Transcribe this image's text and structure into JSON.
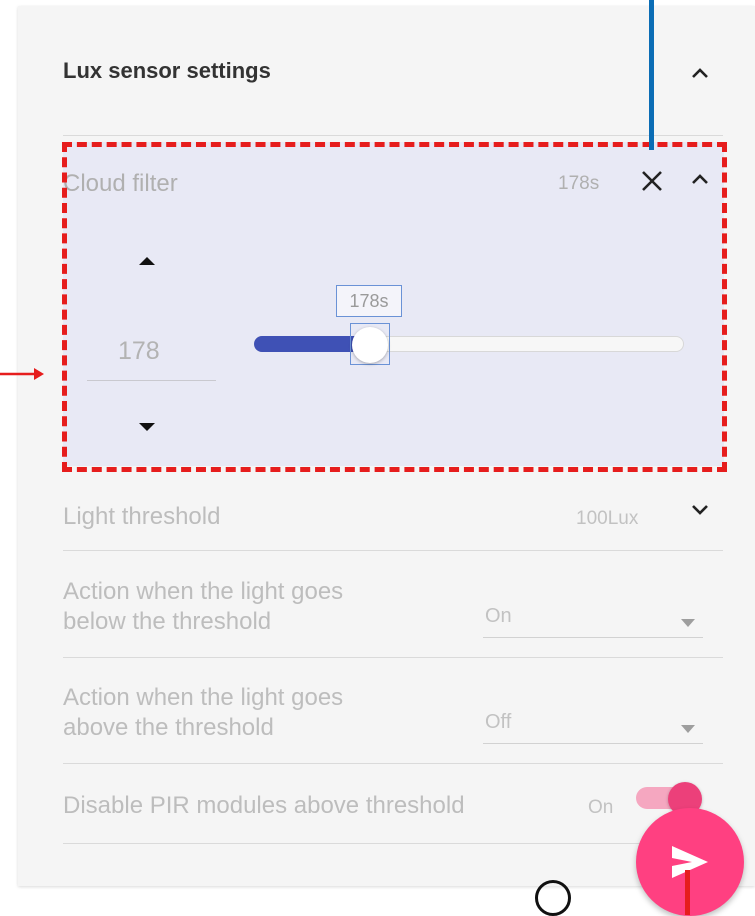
{
  "section": {
    "title": "Lux sensor settings"
  },
  "cloud_filter": {
    "label": "Cloud filter",
    "value_display": "178s",
    "number_value": "178",
    "slider_tooltip": "178s",
    "slider_fraction": 0.27
  },
  "light_threshold": {
    "label": "Light threshold",
    "value_display": "100Lux"
  },
  "action_below": {
    "label_line1": "Action when the light goes",
    "label_line2": "below the threshold",
    "selected": "On"
  },
  "action_above": {
    "label_line1": "Action when the light goes",
    "label_line2": "above the threshold",
    "selected": "Off"
  },
  "disable_pir": {
    "label": "Disable PIR modules above threshold",
    "state_text": "On"
  },
  "icons": {
    "section_collapse": "chevron-up-icon",
    "cloud_close": "close-icon",
    "cloud_collapse": "chevron-up-icon",
    "number_increment": "triangle-up-icon",
    "number_decrement": "triangle-down-icon",
    "threshold_expand": "chevron-down-icon",
    "select_dropdown": "triangle-down-icon",
    "fab": "send-icon"
  },
  "colors": {
    "accent": "#3f51b5",
    "pink": "#ff4081",
    "annotation_red": "#e61d1d",
    "annotation_blue": "#0b6db5"
  }
}
